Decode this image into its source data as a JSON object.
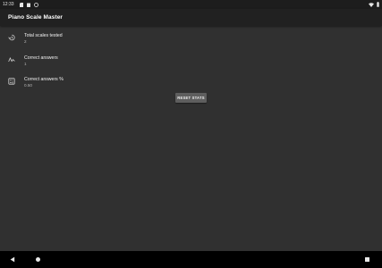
{
  "status_bar": {
    "time": "12:33"
  },
  "app_bar": {
    "title": "Piano Scale Master"
  },
  "stats": {
    "total": {
      "label": "Total scales tested",
      "value": "2",
      "icon": "history-icon"
    },
    "correct": {
      "label": "Correct answers",
      "value": "1",
      "icon": "trending-icon"
    },
    "percent": {
      "label": "Correct answers %",
      "value": "0.50",
      "icon": "percent-icon"
    }
  },
  "actions": {
    "reset_label": "RESET STATS"
  },
  "colors": {
    "background": "#303030",
    "app_bar": "#212121",
    "button": "#5e5e5e"
  }
}
